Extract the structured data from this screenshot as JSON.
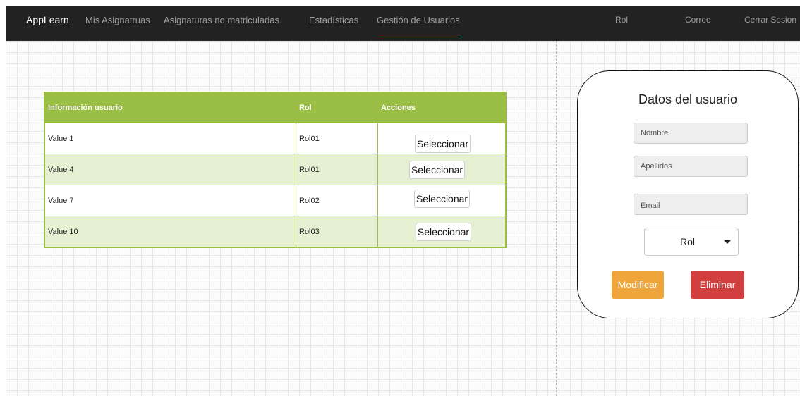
{
  "colors": {
    "navbar_bg": "#222222",
    "table_header": "#9bbf45",
    "table_alt_row": "#e6f0d3",
    "modify_button": "#eea63b",
    "delete_button": "#d13f3f",
    "active_tab_underline": "#d9534f"
  },
  "navbar": {
    "brand": "AppLearn",
    "links": [
      "Mis Asignatruas",
      "Asignaturas no matriculadas",
      "Estadísticas",
      "Gestión de Usuarios"
    ],
    "active": "Gestión de Usuarios",
    "right": [
      "Rol",
      "Correo",
      "Cerrar Sesion"
    ]
  },
  "table": {
    "headers": [
      "Información usuario",
      "Rol",
      "Acciones"
    ],
    "rows": [
      {
        "info": "Value 1",
        "rol": "Rol01",
        "action": "Seleccionar"
      },
      {
        "info": "Value 4",
        "rol": "Rol01",
        "action": "Seleccionar"
      },
      {
        "info": "Value 7",
        "rol": "Rol02",
        "action": "Seleccionar"
      },
      {
        "info": "Value 10",
        "rol": "Rol03",
        "action": "Seleccionar"
      }
    ]
  },
  "form": {
    "title": "Datos del  usuario",
    "nombre_placeholder": "Nombre",
    "apellidos_placeholder": "Apellidos",
    "email_placeholder": "Email",
    "rol_selected": "Rol",
    "modify_label": "Modificar",
    "delete_label": "Eliminar"
  }
}
